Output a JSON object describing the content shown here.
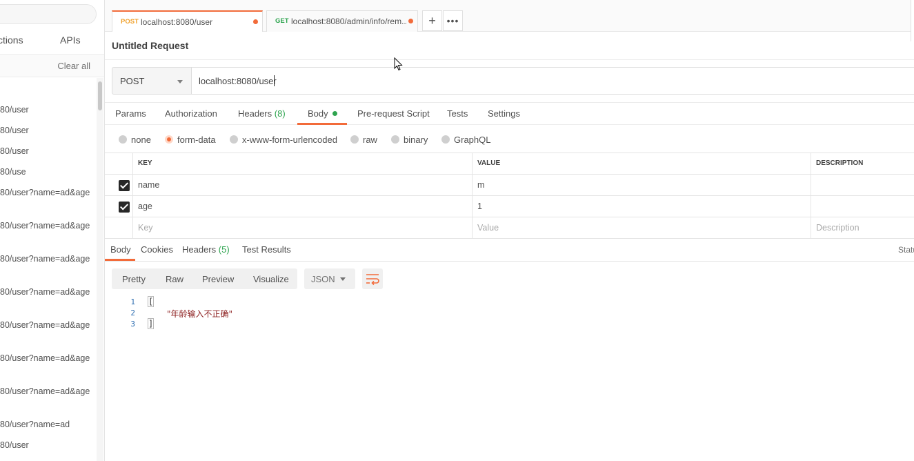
{
  "sidebar": {
    "tabs": [
      {
        "label": "ctions"
      },
      {
        "label": "APIs"
      }
    ],
    "clear_all": "Clear all",
    "history": [
      "80/user",
      "80/user",
      "80/user",
      "80/use",
      "80/user?name=ad&age",
      "80/user?name=ad&age",
      "80/user?name=ad&age",
      "80/user?name=ad&age",
      "80/user?name=ad&age",
      "80/user?name=ad&age",
      "80/user?name=ad&age",
      "80/user?name=ad",
      "80/user"
    ]
  },
  "tabs": [
    {
      "method": "POST",
      "url": "localhost:8080/user",
      "method_color": "#f0a22e"
    },
    {
      "method": "GET",
      "url": "localhost:8080/admin/info/rem...",
      "method_color": "#2ea44f"
    }
  ],
  "request": {
    "title": "Untitled Request",
    "method": "POST",
    "url": "localhost:8080/user",
    "subtabs": {
      "params": "Params",
      "authorization": "Authorization",
      "headers": "Headers",
      "headers_count": "(8)",
      "body": "Body",
      "prerequest": "Pre-request Script",
      "tests": "Tests",
      "settings": "Settings"
    },
    "body_types": [
      "none",
      "form-data",
      "x-www-form-urlencoded",
      "raw",
      "binary",
      "GraphQL"
    ],
    "body_type_selected": "form-data",
    "table": {
      "headers": {
        "key": "KEY",
        "value": "VALUE",
        "description": "DESCRIPTION"
      },
      "rows": [
        {
          "checked": true,
          "key": "name",
          "value": "m",
          "description": ""
        },
        {
          "checked": true,
          "key": "age",
          "value": "1",
          "description": ""
        }
      ],
      "placeholder": {
        "key": "Key",
        "value": "Value",
        "description": "Description"
      }
    }
  },
  "response": {
    "tabs": {
      "body": "Body",
      "cookies": "Cookies",
      "headers": "Headers",
      "headers_count": "(5)",
      "test_results": "Test Results"
    },
    "status_label": "Statu",
    "formats": [
      "Pretty",
      "Raw",
      "Preview",
      "Visualize"
    ],
    "language": "JSON",
    "lines": [
      {
        "n": "1",
        "text": "["
      },
      {
        "n": "2",
        "text": "\"年龄输入不正确\""
      },
      {
        "n": "3",
        "text": "]"
      }
    ]
  },
  "colors": {
    "accent": "#f26b3a",
    "green": "#2ea44f",
    "post": "#f0a22e"
  }
}
